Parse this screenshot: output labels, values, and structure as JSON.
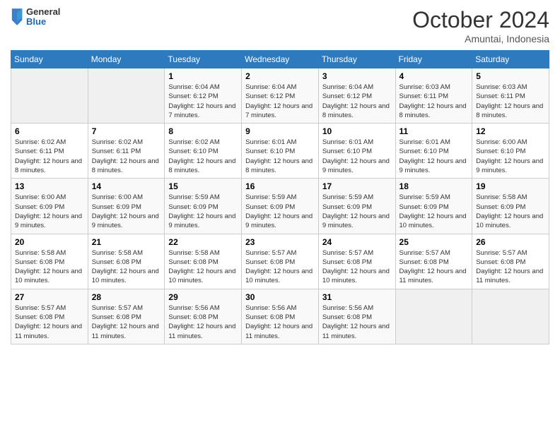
{
  "header": {
    "logo_general": "General",
    "logo_blue": "Blue",
    "month_title": "October 2024",
    "location": "Amuntai, Indonesia"
  },
  "days_of_week": [
    "Sunday",
    "Monday",
    "Tuesday",
    "Wednesday",
    "Thursday",
    "Friday",
    "Saturday"
  ],
  "weeks": [
    [
      {
        "day": "",
        "info": ""
      },
      {
        "day": "",
        "info": ""
      },
      {
        "day": "1",
        "sunrise": "6:04 AM",
        "sunset": "6:12 PM",
        "daylight": "12 hours and 7 minutes."
      },
      {
        "day": "2",
        "sunrise": "6:04 AM",
        "sunset": "6:12 PM",
        "daylight": "12 hours and 7 minutes."
      },
      {
        "day": "3",
        "sunrise": "6:04 AM",
        "sunset": "6:12 PM",
        "daylight": "12 hours and 8 minutes."
      },
      {
        "day": "4",
        "sunrise": "6:03 AM",
        "sunset": "6:11 PM",
        "daylight": "12 hours and 8 minutes."
      },
      {
        "day": "5",
        "sunrise": "6:03 AM",
        "sunset": "6:11 PM",
        "daylight": "12 hours and 8 minutes."
      }
    ],
    [
      {
        "day": "6",
        "sunrise": "6:02 AM",
        "sunset": "6:11 PM",
        "daylight": "12 hours and 8 minutes."
      },
      {
        "day": "7",
        "sunrise": "6:02 AM",
        "sunset": "6:11 PM",
        "daylight": "12 hours and 8 minutes."
      },
      {
        "day": "8",
        "sunrise": "6:02 AM",
        "sunset": "6:10 PM",
        "daylight": "12 hours and 8 minutes."
      },
      {
        "day": "9",
        "sunrise": "6:01 AM",
        "sunset": "6:10 PM",
        "daylight": "12 hours and 8 minutes."
      },
      {
        "day": "10",
        "sunrise": "6:01 AM",
        "sunset": "6:10 PM",
        "daylight": "12 hours and 9 minutes."
      },
      {
        "day": "11",
        "sunrise": "6:01 AM",
        "sunset": "6:10 PM",
        "daylight": "12 hours and 9 minutes."
      },
      {
        "day": "12",
        "sunrise": "6:00 AM",
        "sunset": "6:10 PM",
        "daylight": "12 hours and 9 minutes."
      }
    ],
    [
      {
        "day": "13",
        "sunrise": "6:00 AM",
        "sunset": "6:09 PM",
        "daylight": "12 hours and 9 minutes."
      },
      {
        "day": "14",
        "sunrise": "6:00 AM",
        "sunset": "6:09 PM",
        "daylight": "12 hours and 9 minutes."
      },
      {
        "day": "15",
        "sunrise": "5:59 AM",
        "sunset": "6:09 PM",
        "daylight": "12 hours and 9 minutes."
      },
      {
        "day": "16",
        "sunrise": "5:59 AM",
        "sunset": "6:09 PM",
        "daylight": "12 hours and 9 minutes."
      },
      {
        "day": "17",
        "sunrise": "5:59 AM",
        "sunset": "6:09 PM",
        "daylight": "12 hours and 9 minutes."
      },
      {
        "day": "18",
        "sunrise": "5:59 AM",
        "sunset": "6:09 PM",
        "daylight": "12 hours and 10 minutes."
      },
      {
        "day": "19",
        "sunrise": "5:58 AM",
        "sunset": "6:09 PM",
        "daylight": "12 hours and 10 minutes."
      }
    ],
    [
      {
        "day": "20",
        "sunrise": "5:58 AM",
        "sunset": "6:08 PM",
        "daylight": "12 hours and 10 minutes."
      },
      {
        "day": "21",
        "sunrise": "5:58 AM",
        "sunset": "6:08 PM",
        "daylight": "12 hours and 10 minutes."
      },
      {
        "day": "22",
        "sunrise": "5:58 AM",
        "sunset": "6:08 PM",
        "daylight": "12 hours and 10 minutes."
      },
      {
        "day": "23",
        "sunrise": "5:57 AM",
        "sunset": "6:08 PM",
        "daylight": "12 hours and 10 minutes."
      },
      {
        "day": "24",
        "sunrise": "5:57 AM",
        "sunset": "6:08 PM",
        "daylight": "12 hours and 10 minutes."
      },
      {
        "day": "25",
        "sunrise": "5:57 AM",
        "sunset": "6:08 PM",
        "daylight": "12 hours and 11 minutes."
      },
      {
        "day": "26",
        "sunrise": "5:57 AM",
        "sunset": "6:08 PM",
        "daylight": "12 hours and 11 minutes."
      }
    ],
    [
      {
        "day": "27",
        "sunrise": "5:57 AM",
        "sunset": "6:08 PM",
        "daylight": "12 hours and 11 minutes."
      },
      {
        "day": "28",
        "sunrise": "5:57 AM",
        "sunset": "6:08 PM",
        "daylight": "12 hours and 11 minutes."
      },
      {
        "day": "29",
        "sunrise": "5:56 AM",
        "sunset": "6:08 PM",
        "daylight": "12 hours and 11 minutes."
      },
      {
        "day": "30",
        "sunrise": "5:56 AM",
        "sunset": "6:08 PM",
        "daylight": "12 hours and 11 minutes."
      },
      {
        "day": "31",
        "sunrise": "5:56 AM",
        "sunset": "6:08 PM",
        "daylight": "12 hours and 11 minutes."
      },
      {
        "day": "",
        "info": ""
      },
      {
        "day": "",
        "info": ""
      }
    ]
  ]
}
